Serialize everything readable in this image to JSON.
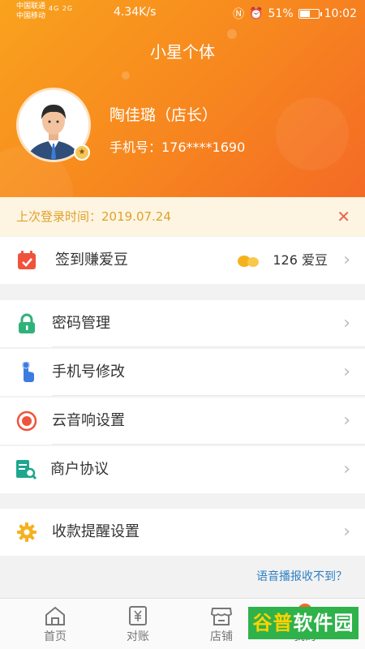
{
  "status_bar": {
    "carrier_1": "中国联通",
    "carrier_2": "中国移动",
    "network": "4G 2G",
    "speed": "4.34K/s",
    "battery": "51%",
    "time": "10:02"
  },
  "header": {
    "title": "小星个体",
    "user_name": "陶佳璐（店长）",
    "user_phone": "手机号：176****1690"
  },
  "notice": {
    "text": "上次登录时间：2019.07.24",
    "close": "✕"
  },
  "rows": {
    "checkin": {
      "label": "签到赚爱豆",
      "beans": "126 爱豆"
    },
    "password": {
      "label": "密码管理"
    },
    "phone_change": {
      "label": "手机号修改"
    },
    "cloud_speaker": {
      "label": "云音响设置"
    },
    "agreement": {
      "label": "商户协议"
    },
    "payment_reminder": {
      "label": "收款提醒设置"
    }
  },
  "help_link": "语音播报收不到？",
  "tabbar": {
    "home": "首页",
    "reconcile": "对账",
    "store": "店铺",
    "me": "我的"
  },
  "watermark": {
    "part1": "谷普",
    "part2": "软件园"
  },
  "colors": {
    "brand_orange": "#f7861f",
    "notice_text": "#e0a12a",
    "link_blue": "#2c7fc3",
    "icon_green": "#2fb27a",
    "icon_blue": "#3d7be0",
    "icon_red": "#f0533c",
    "icon_gold": "#f5b21e"
  },
  "chevron": "›"
}
